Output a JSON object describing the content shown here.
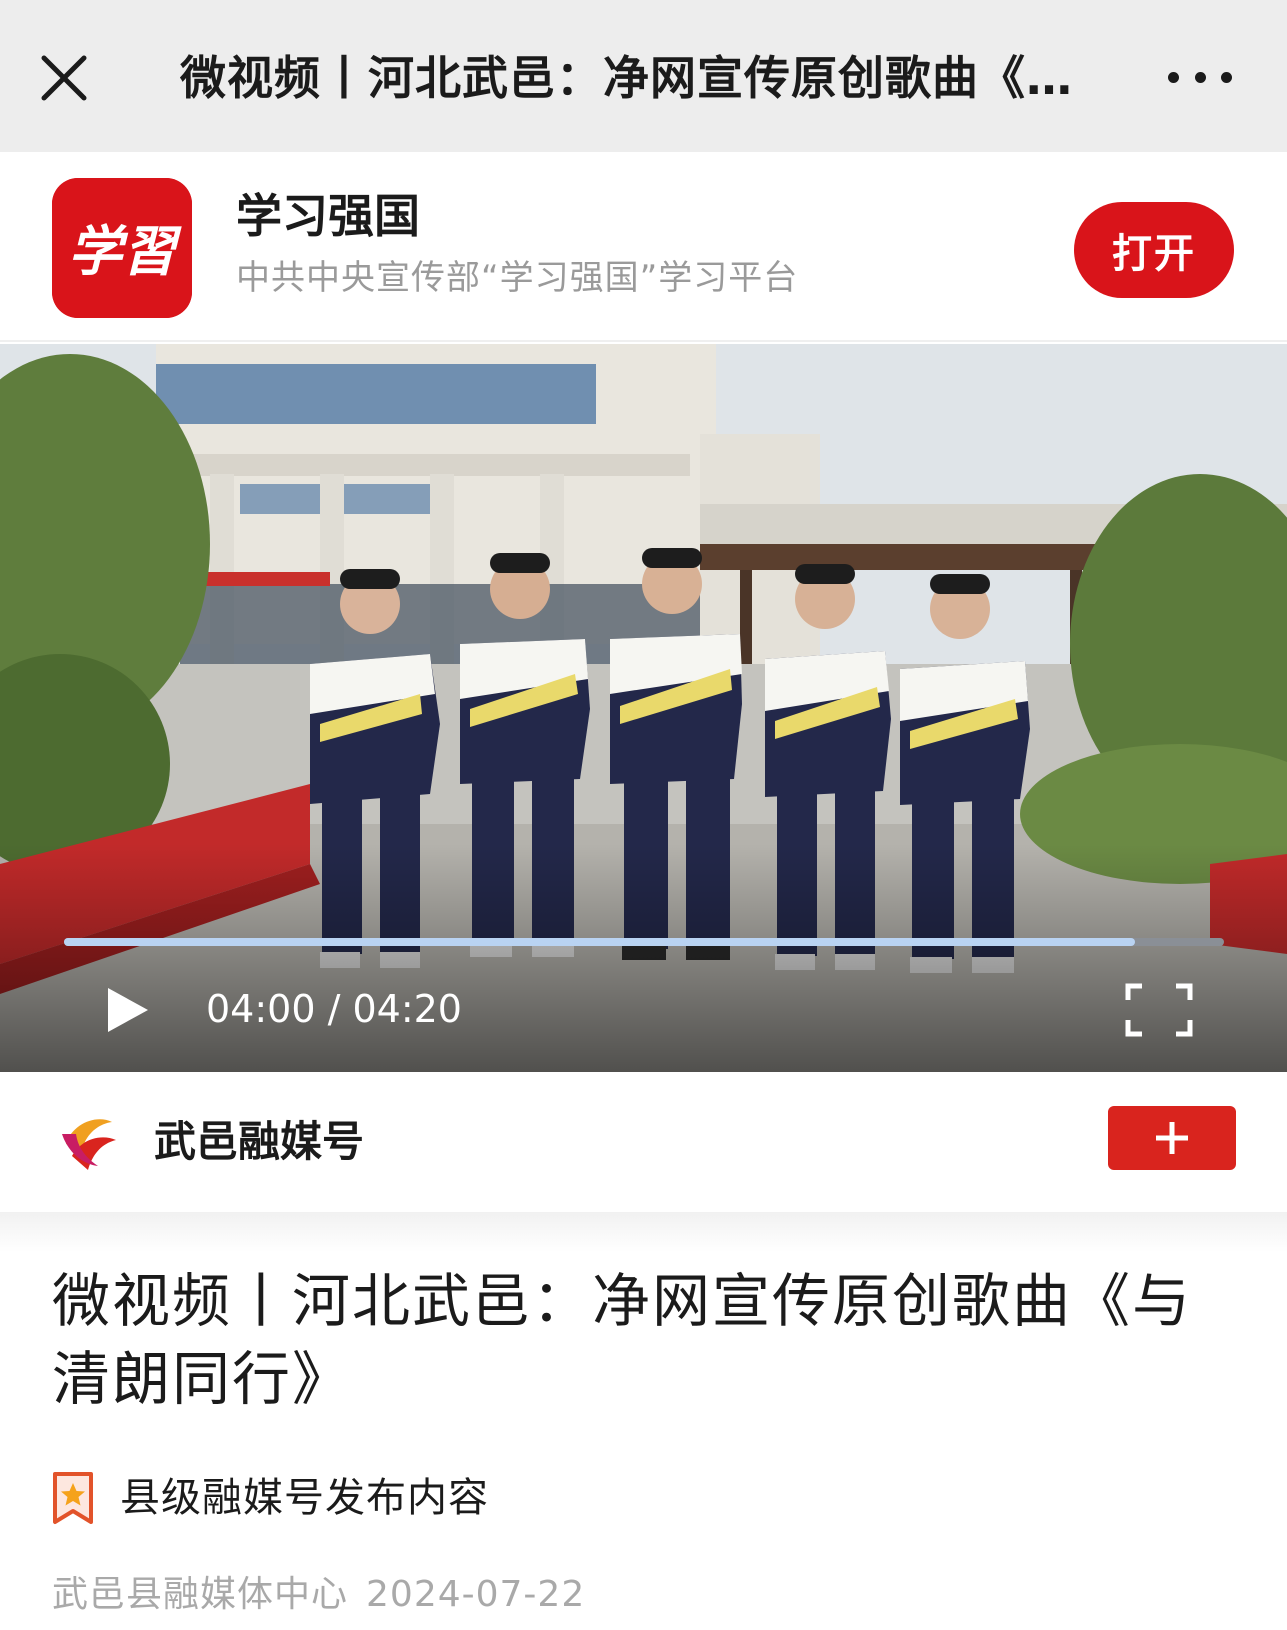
{
  "topbar": {
    "title": "微视频丨河北武邑：净网宣传原创歌曲《与清朗同行》"
  },
  "app_banner": {
    "name": "学习强国",
    "description": "中共中央宣传部“学习强国”学习平台",
    "logo_text": "学習",
    "open_label": "打开"
  },
  "video": {
    "time_text": "04:00 / 04:20",
    "progress": 0.923
  },
  "account": {
    "name": "武邑融媒号",
    "follow_symbol": "+"
  },
  "article": {
    "title": "微视频丨河北武邑：净网宣传原创歌曲《与清朗同行》",
    "tag": "县级融媒号发布内容",
    "source": "武邑县融媒体中心",
    "date": "2024-07-22"
  },
  "colors": {
    "brand_red": "#d9141a",
    "progress_fill": "#b9d3f2"
  }
}
